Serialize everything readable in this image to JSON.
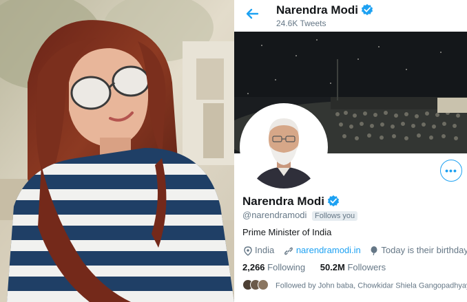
{
  "profile": {
    "header_name": "Narendra Modi",
    "tweet_count": "24.6K Tweets",
    "display_name": "Narendra Modi",
    "handle": "@narendramodi",
    "follows_you": "Follows you",
    "bio": "Prime Minister of India",
    "location": "India",
    "website": "narendramodi.in",
    "birthday": "Today is their birthday",
    "following_count": "2,266",
    "following_label": "Following",
    "followers_count": "50.2M",
    "followers_label": "Followers",
    "followed_by": "Followed by John baba, Chowkidar Shiela Gangopadhyay"
  },
  "colors": {
    "accent": "#1da1f2",
    "text_primary": "#14171a",
    "text_secondary": "#657786"
  },
  "icons": [
    "back-arrow-icon",
    "verified-badge-icon",
    "more-options-icon",
    "location-pin-icon",
    "link-icon",
    "birthday-balloon-icon"
  ]
}
